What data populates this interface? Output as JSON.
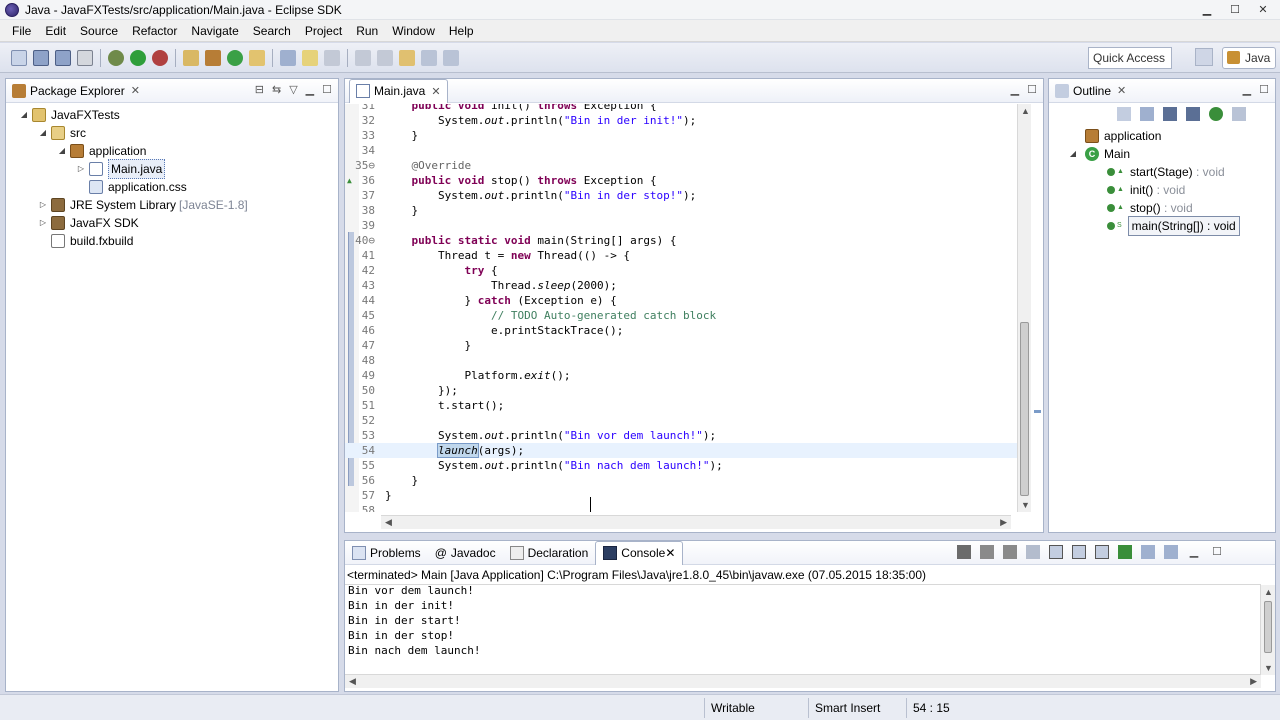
{
  "window": {
    "title": "Java - JavaFXTests/src/application/Main.java - Eclipse SDK"
  },
  "menu": [
    "File",
    "Edit",
    "Source",
    "Refactor",
    "Navigate",
    "Search",
    "Project",
    "Run",
    "Window",
    "Help"
  ],
  "toolbar": {
    "quick_access": "Quick Access",
    "perspective": "Java"
  },
  "package_explorer": {
    "title": "Package Explorer",
    "tree": [
      {
        "label": "JavaFXTests",
        "indent": 0,
        "twisty": "◢",
        "icon": "project"
      },
      {
        "label": "src",
        "indent": 1,
        "twisty": "◢",
        "icon": "srcfolder"
      },
      {
        "label": "application",
        "indent": 2,
        "twisty": "◢",
        "icon": "package"
      },
      {
        "label": "Main.java",
        "indent": 3,
        "twisty": "▷",
        "icon": "javafile",
        "selected": true
      },
      {
        "label": "application.css",
        "indent": 3,
        "twisty": "",
        "icon": "cssfile"
      },
      {
        "label": "JRE System Library",
        "extra": "[JavaSE-1.8]",
        "indent": 1,
        "twisty": "▷",
        "icon": "library"
      },
      {
        "label": "JavaFX SDK",
        "indent": 1,
        "twisty": "▷",
        "icon": "library"
      },
      {
        "label": "build.fxbuild",
        "indent": 1,
        "twisty": "",
        "icon": "fxbuild"
      }
    ]
  },
  "editor": {
    "tab": "Main.java",
    "lines": [
      {
        "n": "31",
        "html": "    <span class='kw'>public</span> <span class='kw'>void</span> init() <span class='kw'>throws</span> Exception {"
      },
      {
        "n": "32",
        "html": "        System.<span class='it'>out</span>.println(<span class='str'>\"Bin in der init!\"</span>);"
      },
      {
        "n": "33",
        "html": "    }"
      },
      {
        "n": "34",
        "html": ""
      },
      {
        "n": "35⊖",
        "html": "    <span class='anno'>@Override</span>"
      },
      {
        "n": "36",
        "mark": "▲",
        "html": "    <span class='kw'>public</span> <span class='kw'>void</span> stop() <span class='kw'>throws</span> Exception {"
      },
      {
        "n": "37",
        "html": "        System.<span class='it'>out</span>.println(<span class='str'>\"Bin in der stop!\"</span>);"
      },
      {
        "n": "38",
        "html": "    }"
      },
      {
        "n": "39",
        "html": ""
      },
      {
        "n": "40⊖",
        "html": "    <span class='kw'>public</span> <span class='kw'>static</span> <span class='kw'>void</span> main(String[] args) {"
      },
      {
        "n": "41",
        "html": "        Thread t = <span class='kw'>new</span> Thread(() -> {"
      },
      {
        "n": "42",
        "html": "            <span class='kw'>try</span> {"
      },
      {
        "n": "43",
        "html": "                Thread.<span class='it'>sleep</span>(2000);"
      },
      {
        "n": "44",
        "html": "            } <span class='kw'>catch</span> (Exception e) {"
      },
      {
        "n": "45",
        "html": "                <span class='cm'>// TODO Auto-generated catch block</span>"
      },
      {
        "n": "46",
        "html": "                e.printStackTrace();"
      },
      {
        "n": "47",
        "html": "            }"
      },
      {
        "n": "48",
        "html": ""
      },
      {
        "n": "49",
        "html": "            Platform.<span class='it'>exit</span>();"
      },
      {
        "n": "50",
        "html": "        });"
      },
      {
        "n": "51",
        "html": "        t.start();"
      },
      {
        "n": "52",
        "html": ""
      },
      {
        "n": "53",
        "html": "        System.<span class='it'>out</span>.println(<span class='str'>\"Bin vor dem launch!\"</span>);"
      },
      {
        "n": "54",
        "current": true,
        "html": "        <span class='sel-word'>launch</span>(args);"
      },
      {
        "n": "55",
        "html": "        System.<span class='it'>out</span>.println(<span class='str'>\"Bin nach dem launch!\"</span>);"
      },
      {
        "n": "56",
        "html": "    }"
      },
      {
        "n": "57",
        "html": "}"
      },
      {
        "n": "58",
        "html": ""
      }
    ]
  },
  "outline": {
    "title": "Outline",
    "items": [
      {
        "label": "application",
        "kind": "package"
      },
      {
        "label": "Main",
        "kind": "class"
      },
      {
        "label": "start(Stage)",
        "type": " : void",
        "kind": "method"
      },
      {
        "label": "init()",
        "type": " : void",
        "kind": "method"
      },
      {
        "label": "stop()",
        "type": " : void",
        "kind": "method"
      },
      {
        "label": "main(String[])",
        "type": " : void",
        "kind": "static-method",
        "selected": true
      }
    ]
  },
  "console": {
    "tabs": [
      "Problems",
      "Javadoc",
      "Declaration",
      "Console"
    ],
    "status": "<terminated> Main [Java Application] C:\\Program Files\\Java\\jre1.8.0_45\\bin\\javaw.exe (07.05.2015 18:35:00)",
    "lines": [
      "Bin vor dem launch!",
      "Bin in der init!",
      "Bin in der start!",
      "Bin in der stop!",
      "Bin nach dem launch!"
    ]
  },
  "statusbar": {
    "writable": "Writable",
    "insert_mode": "Smart Insert",
    "position": "54 : 15"
  },
  "colors": {
    "keyword": "#7f0055",
    "string": "#2a00ff",
    "comment": "#3f7f5f",
    "panel_border": "#a8b3c9",
    "workbench_bg": "#d6dbe9"
  }
}
